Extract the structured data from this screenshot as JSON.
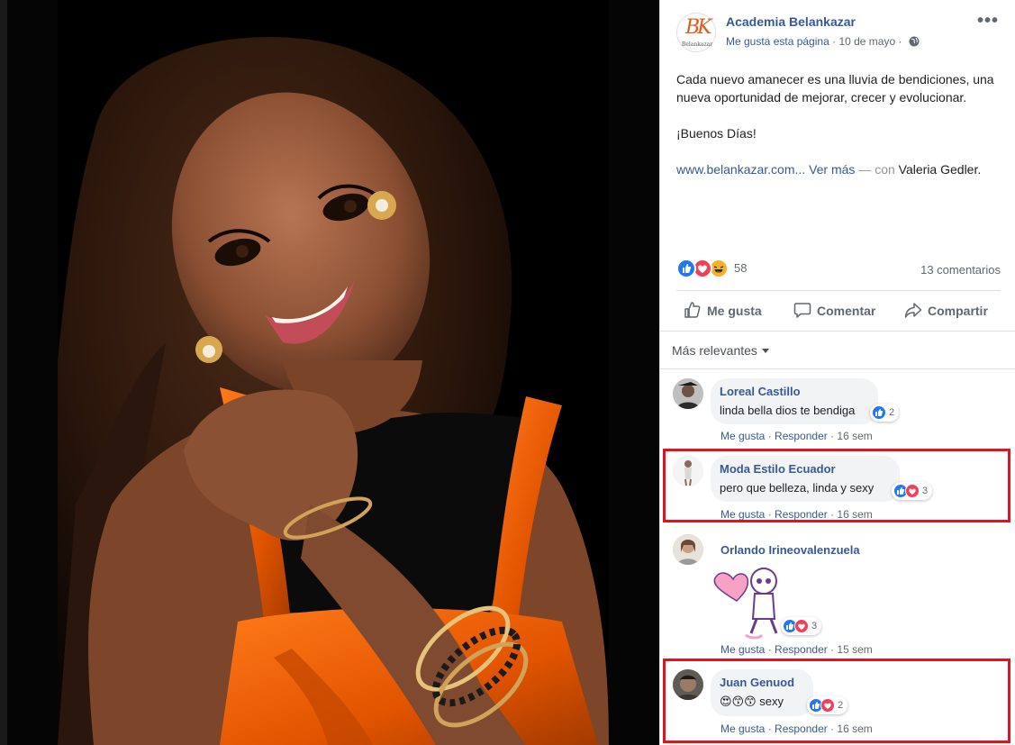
{
  "post": {
    "page_name": "Academia Belankazar",
    "page_avatar_initials": "BK",
    "page_avatar_sub": "Belankazar",
    "like_page": "Me gusta esta página",
    "date": "10 de mayo",
    "separator": "·",
    "more": "•••",
    "text_line1": "Cada nuevo amanecer es una lluvia de bendiciones, una nueva oportunidad de mejorar, crecer y evolucionar.",
    "text_line2": "¡Buenos Días!",
    "link": "www.belankazar.com...",
    "see_more": "Ver más",
    "with_dash": " — con ",
    "tagged": "Valeria Gedler",
    "tagged_end": "."
  },
  "reactions": {
    "count": "58",
    "comments": "13 comentarios",
    "colors": {
      "like": "#2078f4",
      "love": "#f33e58",
      "haha": "#f7b125"
    }
  },
  "actions": {
    "like": "Me gusta",
    "comment": "Comentar",
    "share": "Compartir"
  },
  "sort_label": "Más relevantes",
  "comments": [
    {
      "author": "Loreal Castillo",
      "text": "linda bella dios te bendiga",
      "reaction_count": "2",
      "like": "Me gusta",
      "reply": "Responder",
      "time": "16 sem"
    },
    {
      "author": "Moda Estilo Ecuador",
      "text": "pero que belleza, linda y sexy",
      "reaction_count": "3",
      "like": "Me gusta",
      "reply": "Responder",
      "time": "16 sem"
    },
    {
      "author": "Orlando Irineovalenzuela",
      "text": "",
      "reaction_count": "3",
      "like": "Me gusta",
      "reply": "Responder",
      "time": "15 sem"
    },
    {
      "author": "Juan Genuod",
      "text": "😍😙😙 sexy",
      "reaction_count": "2",
      "like": "Me gusta",
      "reply": "Responder",
      "time": "16 sem"
    }
  ],
  "highlight_color": "#e0141e"
}
